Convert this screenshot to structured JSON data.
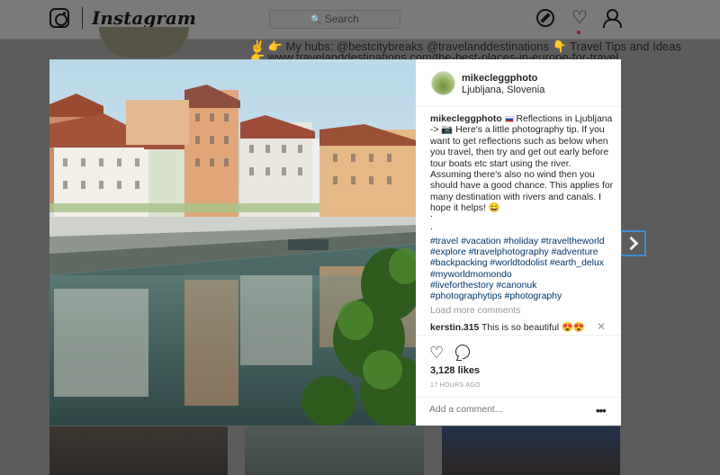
{
  "header": {
    "wordmark": "Instagram",
    "search_placeholder": "Search",
    "icons": [
      "instagram-logo-icon",
      "explore-compass-icon",
      "activity-heart-icon",
      "profile-person-icon"
    ]
  },
  "profile": {
    "bio_line1": "✌️ 👉 My hubs: @bestcitybreaks @travelanddestinations 👇 Travel Tips and Ideas",
    "bio_line2": "👉 www.travelanddestinations.com/the-best-places-in-europe-for-travel"
  },
  "post": {
    "username": "mikecleggphoto",
    "location": "Ljubljana, Slovenia",
    "caption_user": "mikecleggphoto",
    "caption_text": " Reflections in Ljubljana -> 📷 Here's a little photography tip. If you want to get reflections such as below when you travel, then try and get out early before tour boats etc start using the river. Assuming there's also no wind then you should have a good chance. This applies for many destination with rivers and canals. I hope it helps! 😄",
    "dot": ".",
    "hashtag_lines": [
      "#travel #vacation #holiday #traveltheworld",
      "#explore #travelphotography #adventure",
      "#backpacking #worldtodolist #earth_delux",
      "#myworldmomondo",
      "#liveforthestory #canonuk",
      "#photographytips #photography"
    ],
    "load_more": "Load more comments",
    "comment_user": "kerstin.315",
    "comment_text": " This is so beautiful 😍😍",
    "likes": "3,128 likes",
    "time_ago": "17 HOURS AGO",
    "add_comment_placeholder": "Add a comment...",
    "more": "•••"
  },
  "colors": {
    "hashtag": "#003569",
    "overlay": "#5c5c5c",
    "focus": "#3a8fd8"
  }
}
